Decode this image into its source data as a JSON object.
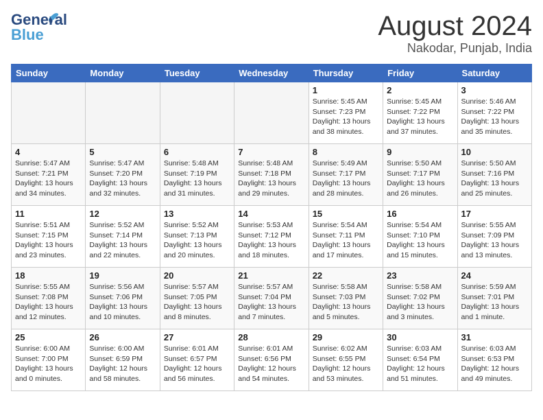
{
  "header": {
    "logo_general": "General",
    "logo_blue": "Blue",
    "month": "August 2024",
    "location": "Nakodar, Punjab, India"
  },
  "days_of_week": [
    "Sunday",
    "Monday",
    "Tuesday",
    "Wednesday",
    "Thursday",
    "Friday",
    "Saturday"
  ],
  "weeks": [
    [
      {
        "num": "",
        "detail": ""
      },
      {
        "num": "",
        "detail": ""
      },
      {
        "num": "",
        "detail": ""
      },
      {
        "num": "",
        "detail": ""
      },
      {
        "num": "1",
        "detail": "Sunrise: 5:45 AM\nSunset: 7:23 PM\nDaylight: 13 hours\nand 38 minutes."
      },
      {
        "num": "2",
        "detail": "Sunrise: 5:45 AM\nSunset: 7:22 PM\nDaylight: 13 hours\nand 37 minutes."
      },
      {
        "num": "3",
        "detail": "Sunrise: 5:46 AM\nSunset: 7:22 PM\nDaylight: 13 hours\nand 35 minutes."
      }
    ],
    [
      {
        "num": "4",
        "detail": "Sunrise: 5:47 AM\nSunset: 7:21 PM\nDaylight: 13 hours\nand 34 minutes."
      },
      {
        "num": "5",
        "detail": "Sunrise: 5:47 AM\nSunset: 7:20 PM\nDaylight: 13 hours\nand 32 minutes."
      },
      {
        "num": "6",
        "detail": "Sunrise: 5:48 AM\nSunset: 7:19 PM\nDaylight: 13 hours\nand 31 minutes."
      },
      {
        "num": "7",
        "detail": "Sunrise: 5:48 AM\nSunset: 7:18 PM\nDaylight: 13 hours\nand 29 minutes."
      },
      {
        "num": "8",
        "detail": "Sunrise: 5:49 AM\nSunset: 7:17 PM\nDaylight: 13 hours\nand 28 minutes."
      },
      {
        "num": "9",
        "detail": "Sunrise: 5:50 AM\nSunset: 7:17 PM\nDaylight: 13 hours\nand 26 minutes."
      },
      {
        "num": "10",
        "detail": "Sunrise: 5:50 AM\nSunset: 7:16 PM\nDaylight: 13 hours\nand 25 minutes."
      }
    ],
    [
      {
        "num": "11",
        "detail": "Sunrise: 5:51 AM\nSunset: 7:15 PM\nDaylight: 13 hours\nand 23 minutes."
      },
      {
        "num": "12",
        "detail": "Sunrise: 5:52 AM\nSunset: 7:14 PM\nDaylight: 13 hours\nand 22 minutes."
      },
      {
        "num": "13",
        "detail": "Sunrise: 5:52 AM\nSunset: 7:13 PM\nDaylight: 13 hours\nand 20 minutes."
      },
      {
        "num": "14",
        "detail": "Sunrise: 5:53 AM\nSunset: 7:12 PM\nDaylight: 13 hours\nand 18 minutes."
      },
      {
        "num": "15",
        "detail": "Sunrise: 5:54 AM\nSunset: 7:11 PM\nDaylight: 13 hours\nand 17 minutes."
      },
      {
        "num": "16",
        "detail": "Sunrise: 5:54 AM\nSunset: 7:10 PM\nDaylight: 13 hours\nand 15 minutes."
      },
      {
        "num": "17",
        "detail": "Sunrise: 5:55 AM\nSunset: 7:09 PM\nDaylight: 13 hours\nand 13 minutes."
      }
    ],
    [
      {
        "num": "18",
        "detail": "Sunrise: 5:55 AM\nSunset: 7:08 PM\nDaylight: 13 hours\nand 12 minutes."
      },
      {
        "num": "19",
        "detail": "Sunrise: 5:56 AM\nSunset: 7:06 PM\nDaylight: 13 hours\nand 10 minutes."
      },
      {
        "num": "20",
        "detail": "Sunrise: 5:57 AM\nSunset: 7:05 PM\nDaylight: 13 hours\nand 8 minutes."
      },
      {
        "num": "21",
        "detail": "Sunrise: 5:57 AM\nSunset: 7:04 PM\nDaylight: 13 hours\nand 7 minutes."
      },
      {
        "num": "22",
        "detail": "Sunrise: 5:58 AM\nSunset: 7:03 PM\nDaylight: 13 hours\nand 5 minutes."
      },
      {
        "num": "23",
        "detail": "Sunrise: 5:58 AM\nSunset: 7:02 PM\nDaylight: 13 hours\nand 3 minutes."
      },
      {
        "num": "24",
        "detail": "Sunrise: 5:59 AM\nSunset: 7:01 PM\nDaylight: 13 hours\nand 1 minute."
      }
    ],
    [
      {
        "num": "25",
        "detail": "Sunrise: 6:00 AM\nSunset: 7:00 PM\nDaylight: 13 hours\nand 0 minutes."
      },
      {
        "num": "26",
        "detail": "Sunrise: 6:00 AM\nSunset: 6:59 PM\nDaylight: 12 hours\nand 58 minutes."
      },
      {
        "num": "27",
        "detail": "Sunrise: 6:01 AM\nSunset: 6:57 PM\nDaylight: 12 hours\nand 56 minutes."
      },
      {
        "num": "28",
        "detail": "Sunrise: 6:01 AM\nSunset: 6:56 PM\nDaylight: 12 hours\nand 54 minutes."
      },
      {
        "num": "29",
        "detail": "Sunrise: 6:02 AM\nSunset: 6:55 PM\nDaylight: 12 hours\nand 53 minutes."
      },
      {
        "num": "30",
        "detail": "Sunrise: 6:03 AM\nSunset: 6:54 PM\nDaylight: 12 hours\nand 51 minutes."
      },
      {
        "num": "31",
        "detail": "Sunrise: 6:03 AM\nSunset: 6:53 PM\nDaylight: 12 hours\nand 49 minutes."
      }
    ]
  ]
}
